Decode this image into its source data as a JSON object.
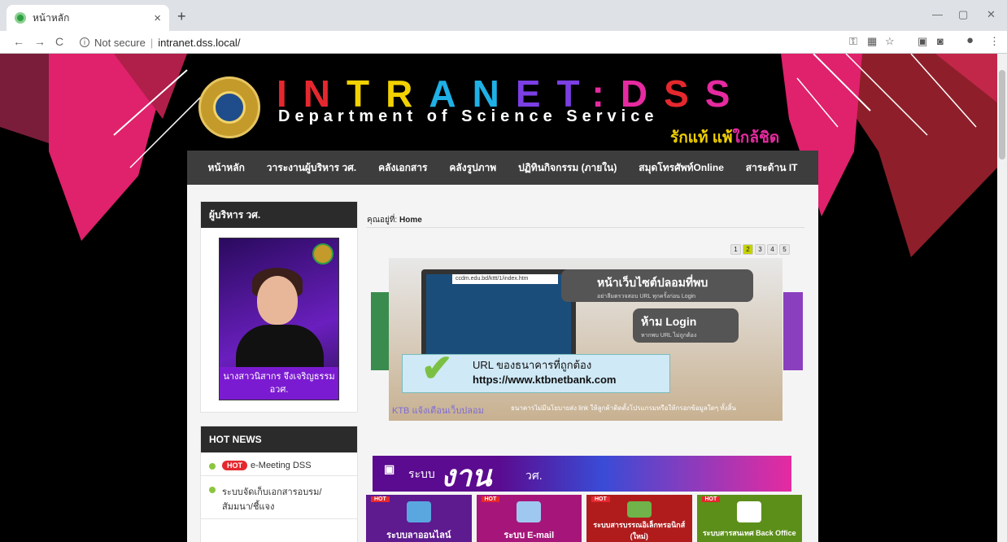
{
  "browser": {
    "tab_title": "หน้าหลัก",
    "tab_close": "×",
    "new_tab": "+",
    "not_secure": "Not secure",
    "separator": "|",
    "url": "intranet.dss.local/",
    "win_min": "—",
    "win_max": "▢",
    "win_close": "✕",
    "back": "←",
    "forward": "→",
    "reload": "C",
    "bookmark_star": "☆",
    "menu": "⋮"
  },
  "site": {
    "title_letters": [
      "I",
      "N",
      "T",
      "R",
      "A",
      "N",
      "E",
      "T",
      ":",
      "D",
      "S",
      "S"
    ],
    "title_colors": [
      "#e5282e",
      "#e5282e",
      "#f2d100",
      "#f2d100",
      "#1fb0e6",
      "#1fb0e6",
      "#7b3fe4",
      "#7b3fe4",
      "#e62aa0",
      "#e62aa0",
      "#e5282e",
      "#e62aa0"
    ],
    "subtitle": "Department of Science Service",
    "slogan_main": "รักแท้ แพ้",
    "slogan_accent": "ใกล้ชิด"
  },
  "menu": [
    "หน้าหลัก",
    "วาระงานผู้บริหาร วศ.",
    "คลังเอกสาร",
    "คลังรูปภาพ",
    "ปฏิทินกิจกรรม (ภายใน)",
    "สมุดโทรศัพท์Online",
    "สาระด้าน IT"
  ],
  "sidebar": {
    "exec_heading": "ผู้บริหาร วศ.",
    "exec_name": "นางสาวนิสากร จึงเจริญธรรม",
    "exec_title": "อวศ.",
    "news_heading": "HOT NEWS",
    "news": [
      {
        "hot": "HOT",
        "text": "e-Meeting DSS"
      },
      {
        "hot": "",
        "text": "ระบบจัดเก็บเอกสารอบรม/สัมมนา/ชี้แจง"
      }
    ]
  },
  "main": {
    "breadcrumb_prefix": "คุณอยู่ที่:",
    "breadcrumb_page": "Home",
    "pages": [
      "1",
      "2",
      "3",
      "4",
      "5"
    ],
    "active_page": "2",
    "slide": {
      "url_strip": "ccdm.edu.bd/kttt/1/index.htm",
      "fake_title": "หน้าเว็บไซต์ปลอมที่พบ",
      "fake_sub": "อย่าลืมตรวจสอบ URL ทุกครั้งก่อน Login",
      "no_login_title": "ห้าม Login",
      "no_login_sub": "หากพบ URL ไม่ถูกต้อง",
      "correct_label": "URL ของธนาคารที่ถูกต้อง",
      "correct_url": "https://www.ktbnetbank.com",
      "note": "ธนาคารไม่มีนโยบายส่ง link ให้ลูกค้าติดตั้งโปรแกรมหรือให้กรอกข้อมูลใดๆ ทั้งสิ้น",
      "caption": "KTB แจ้งเตือนเว็บปลอม"
    },
    "banner": {
      "prefix": "ระบบ",
      "big": "งาน",
      "suffix": "วศ."
    },
    "tiles": [
      {
        "hot": "HOT",
        "label": "ระบบลาออนไลน์",
        "color": "#5e1a8f"
      },
      {
        "hot": "HOT",
        "label": "ระบบ E-mail",
        "color": "#a6167a"
      },
      {
        "hot": "HOT",
        "label": "ระบบสารบรรณอิเล็กทรอนิกส์ (ใหม่)",
        "color": "#b01c1c"
      },
      {
        "hot": "HOT",
        "label": "ระบบสารสนเทศ Back Office",
        "color": "#5c8f1a"
      }
    ]
  }
}
